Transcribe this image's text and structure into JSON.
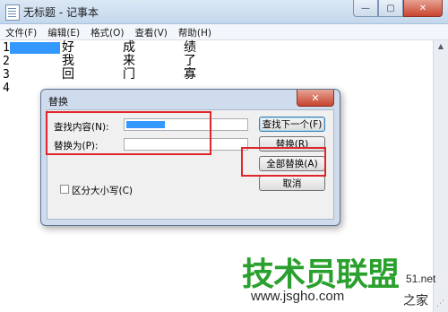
{
  "notepad": {
    "title": "无标题 - 记事本",
    "window_buttons": {
      "minimize": "—",
      "maximize": "▢",
      "close": "✕"
    },
    "menu": [
      "文件(F)",
      "编辑(E)",
      "格式(O)",
      "查看(V)",
      "帮助(H)"
    ],
    "lines": [
      {
        "num": "1",
        "c1": "好",
        "c2": "成",
        "c3": "绩"
      },
      {
        "num": "2",
        "c1": "我",
        "c2": "来",
        "c3": "了"
      },
      {
        "num": "3",
        "c1": "回",
        "c2": "门",
        "c3": "寡"
      },
      {
        "num": "4",
        "c1": "",
        "c2": "",
        "c3": ""
      }
    ]
  },
  "replace_dialog": {
    "title": "替换",
    "find_label": "查找内容(N):",
    "replace_label": "替换为(P):",
    "match_case_label": "区分大小写(C)",
    "buttons": {
      "find_next": "查找下一个(F)",
      "replace": "替换(R)",
      "replace_all": "全部替换(A)",
      "cancel": "取消"
    },
    "close_glyph": "✕"
  },
  "watermark": {
    "main": "技术员联盟",
    "url": "www.jsgho.com",
    "side": "51.net",
    "side2": "之家"
  },
  "colors": {
    "annotation": "#e0262b",
    "selection": "#3399ff",
    "watermark_green": "#2aa02e"
  }
}
